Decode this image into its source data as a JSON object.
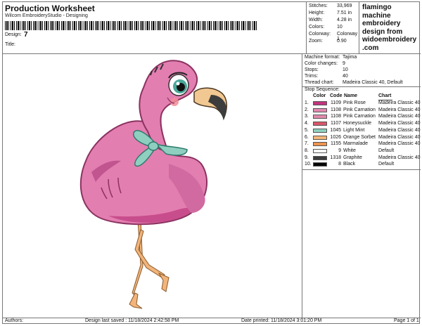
{
  "header": {
    "title": "Production Worksheet",
    "subtitle": "Wilcom EmbroideryStudio - Designing",
    "design_label": "Design:",
    "design_value": "7",
    "title_label": "Title:"
  },
  "stats": [
    {
      "label": "Stitches:",
      "value": "33,969"
    },
    {
      "label": "Height:",
      "value": "7.51 in"
    },
    {
      "label": "Width:",
      "value": "4.28 in"
    },
    {
      "label": "Colors:",
      "value": "10"
    },
    {
      "label": "Colorway:",
      "value": "Colorway 1"
    },
    {
      "label": "Zoom:",
      "value": "0.90"
    }
  ],
  "brand": {
    "line1": "flamingo",
    "line2": "machine",
    "line3": "embroidery",
    "line4": "design from",
    "line5": "widoembroidery",
    "line6": ".com"
  },
  "machine": [
    {
      "label": "Machine format:",
      "value": "Tajima"
    },
    {
      "label": "Color changes:",
      "value": "9"
    },
    {
      "label": "Stops:",
      "value": "10"
    },
    {
      "label": "Trims:",
      "value": "40"
    },
    {
      "label": "Thread chart:",
      "value": "Madeira Classic 40, Default"
    }
  ],
  "stop_sequence": {
    "title": "Stop Sequence:",
    "headers": {
      "color": "Color",
      "code": "Code",
      "name": "Name",
      "chart": "Chart"
    },
    "rows": [
      {
        "num": "1.",
        "color": "#c2357e",
        "code": "1109",
        "name": "Pink Rose",
        "chart": "Madeira Classic 40"
      },
      {
        "num": "2.",
        "color": "#e08aae",
        "code": "1108",
        "name": "Pink Carnation",
        "chart": "Madeira Classic 40"
      },
      {
        "num": "3.",
        "color": "#e08aae",
        "code": "1108",
        "name": "Pink Carnation",
        "chart": "Madeira Classic 40"
      },
      {
        "num": "4.",
        "color": "#d9566b",
        "code": "1107",
        "name": "Honeysuckle",
        "chart": "Madeira Classic 40"
      },
      {
        "num": "5.",
        "color": "#8ecfc0",
        "code": "1045",
        "name": "Light Mint",
        "chart": "Madeira Classic 40"
      },
      {
        "num": "6.",
        "color": "#f4b77a",
        "code": "1026",
        "name": "Orange Sorbet",
        "chart": "Madeira Classic 40"
      },
      {
        "num": "7.",
        "color": "#ee9350",
        "code": "1155",
        "name": "Marmalade",
        "chart": "Madeira Classic 40"
      },
      {
        "num": "8.",
        "color": "#ffffff",
        "code": "9",
        "name": "White",
        "chart": "Default"
      },
      {
        "num": "9.",
        "color": "#3c3c3c",
        "code": "1318",
        "name": "Graphite",
        "chart": "Madeira Classic 40"
      },
      {
        "num": "10.",
        "color": "#050505",
        "code": "8",
        "name": "Black",
        "chart": "Default"
      }
    ]
  },
  "footer": {
    "authors_label": "Authors:",
    "saved": "Design last saved : 11/18/2024 2:42:58 PM",
    "printed": "Date printed: 11/18/2024 3:01:20 PM",
    "page": "Page 1 of 1"
  }
}
